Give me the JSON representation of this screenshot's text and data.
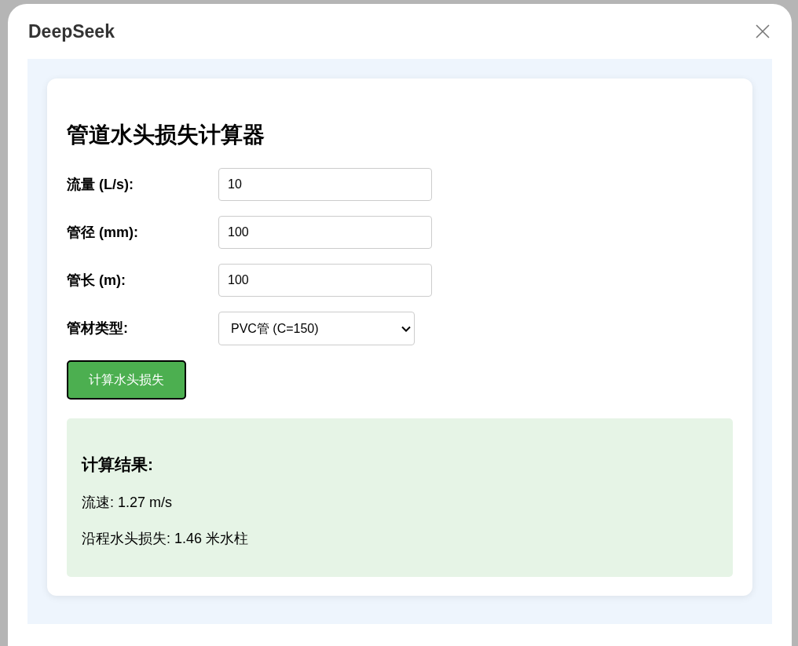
{
  "dialog": {
    "title": "DeepSeek"
  },
  "calculator": {
    "heading": "管道水头损失计算器",
    "fields": [
      {
        "kind": "input",
        "label": "流量 (L/s):",
        "value": "10"
      },
      {
        "kind": "input",
        "label": "管径 (mm):",
        "value": "100"
      },
      {
        "kind": "input",
        "label": "管长 (m):",
        "value": "100"
      },
      {
        "kind": "select",
        "label": "管材类型:",
        "value": "PVC管 (C=150)"
      }
    ],
    "button": "计算水头损失",
    "result": {
      "heading": "计算结果:",
      "lines": [
        "流速: 1.27 m/s",
        "沿程水头损失: 1.46 米水柱"
      ]
    }
  }
}
